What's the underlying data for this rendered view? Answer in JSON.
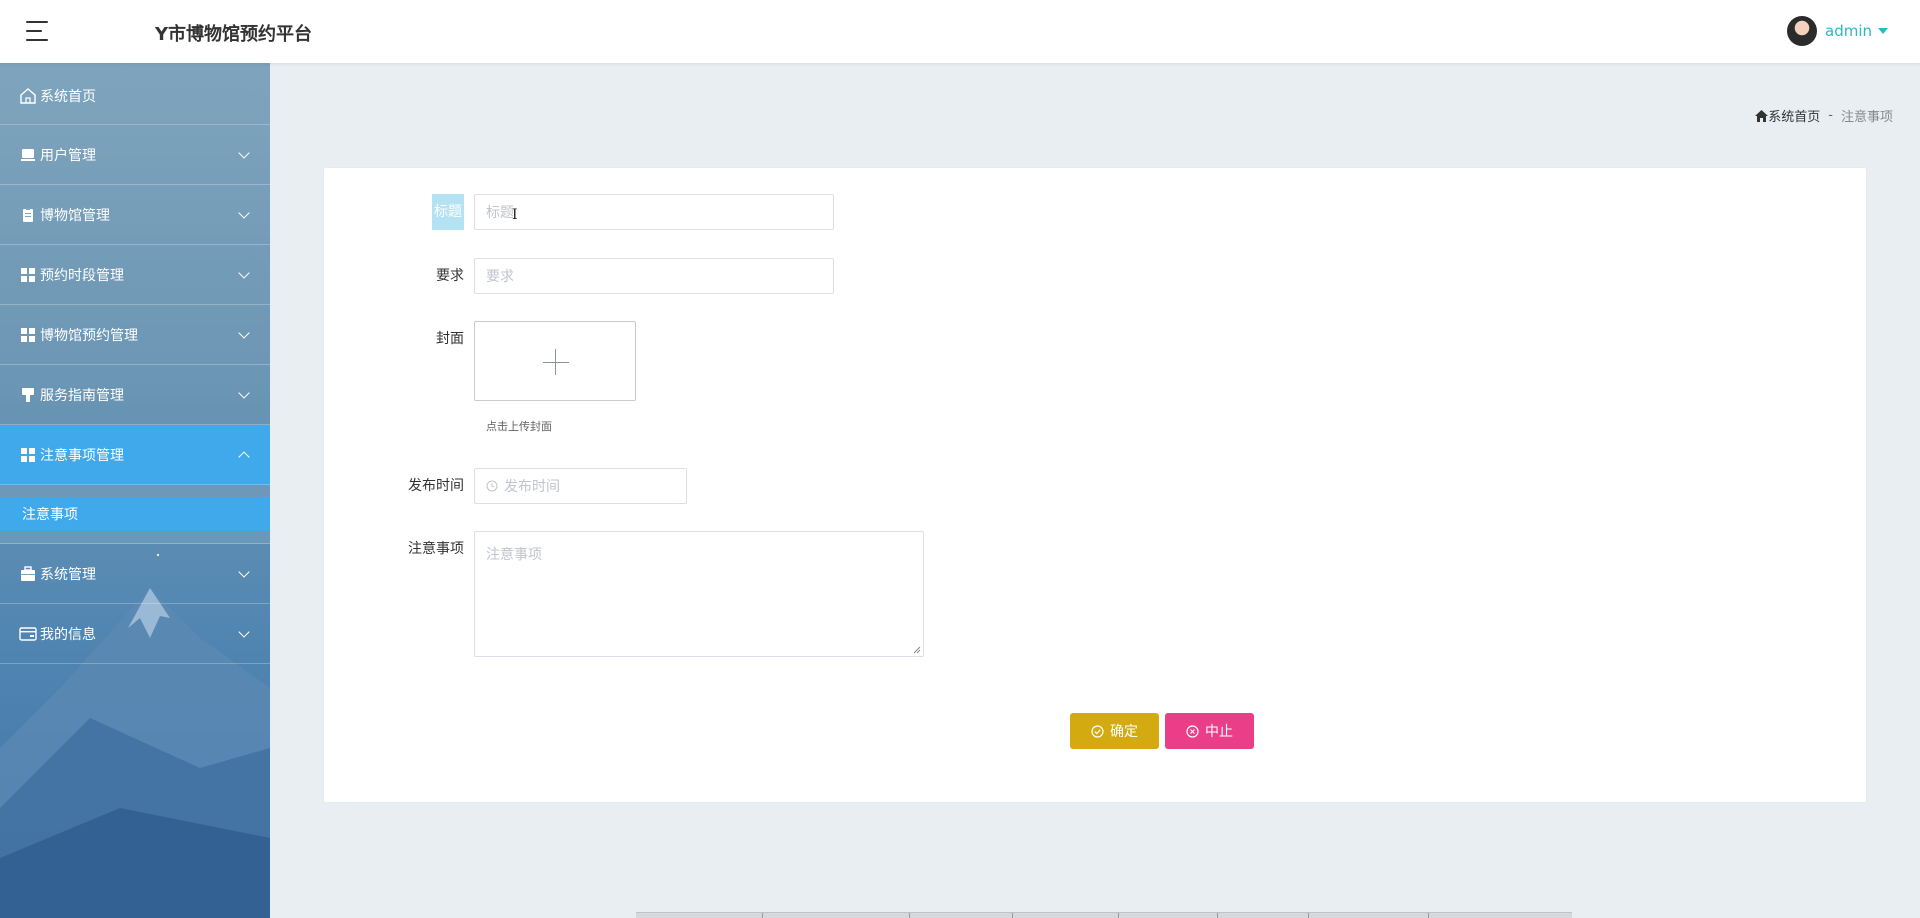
{
  "header": {
    "title": "Y市博物馆预约平台",
    "user_name": "admin"
  },
  "sidebar": {
    "items": [
      {
        "label": "系统首页",
        "icon": "home-icon"
      },
      {
        "label": "用户管理",
        "icon": "user-card-icon"
      },
      {
        "label": "博物馆管理",
        "icon": "clipboard-icon"
      },
      {
        "label": "预约时段管理",
        "icon": "grid-icon"
      },
      {
        "label": "博物馆预约管理",
        "icon": "grid-icon"
      },
      {
        "label": "服务指南管理",
        "icon": "brush-icon"
      },
      {
        "label": "注意事项管理",
        "icon": "grid-icon",
        "expanded": true
      },
      {
        "label": "系统管理",
        "icon": "briefcase-icon"
      },
      {
        "label": "我的信息",
        "icon": "wallet-icon"
      }
    ],
    "submenu": {
      "label": "注意事项"
    }
  },
  "breadcrumb": {
    "home": "系统首页",
    "separator": "-",
    "current": "注意事项"
  },
  "form": {
    "title_label": "标题",
    "title_placeholder": "标题",
    "requirement_label": "要求",
    "requirement_placeholder": "要求",
    "cover_label": "封面",
    "cover_tip": "点击上传封面",
    "publish_time_label": "发布时间",
    "publish_time_placeholder": "发布时间",
    "notes_label": "注意事项",
    "notes_placeholder": "注意事项"
  },
  "buttons": {
    "confirm": "确定",
    "cancel": "中止"
  },
  "colors": {
    "accent": "#3fa9ec",
    "confirm": "#d4aa11",
    "cancel": "#ea3f88",
    "username": "#2bb8c5"
  }
}
